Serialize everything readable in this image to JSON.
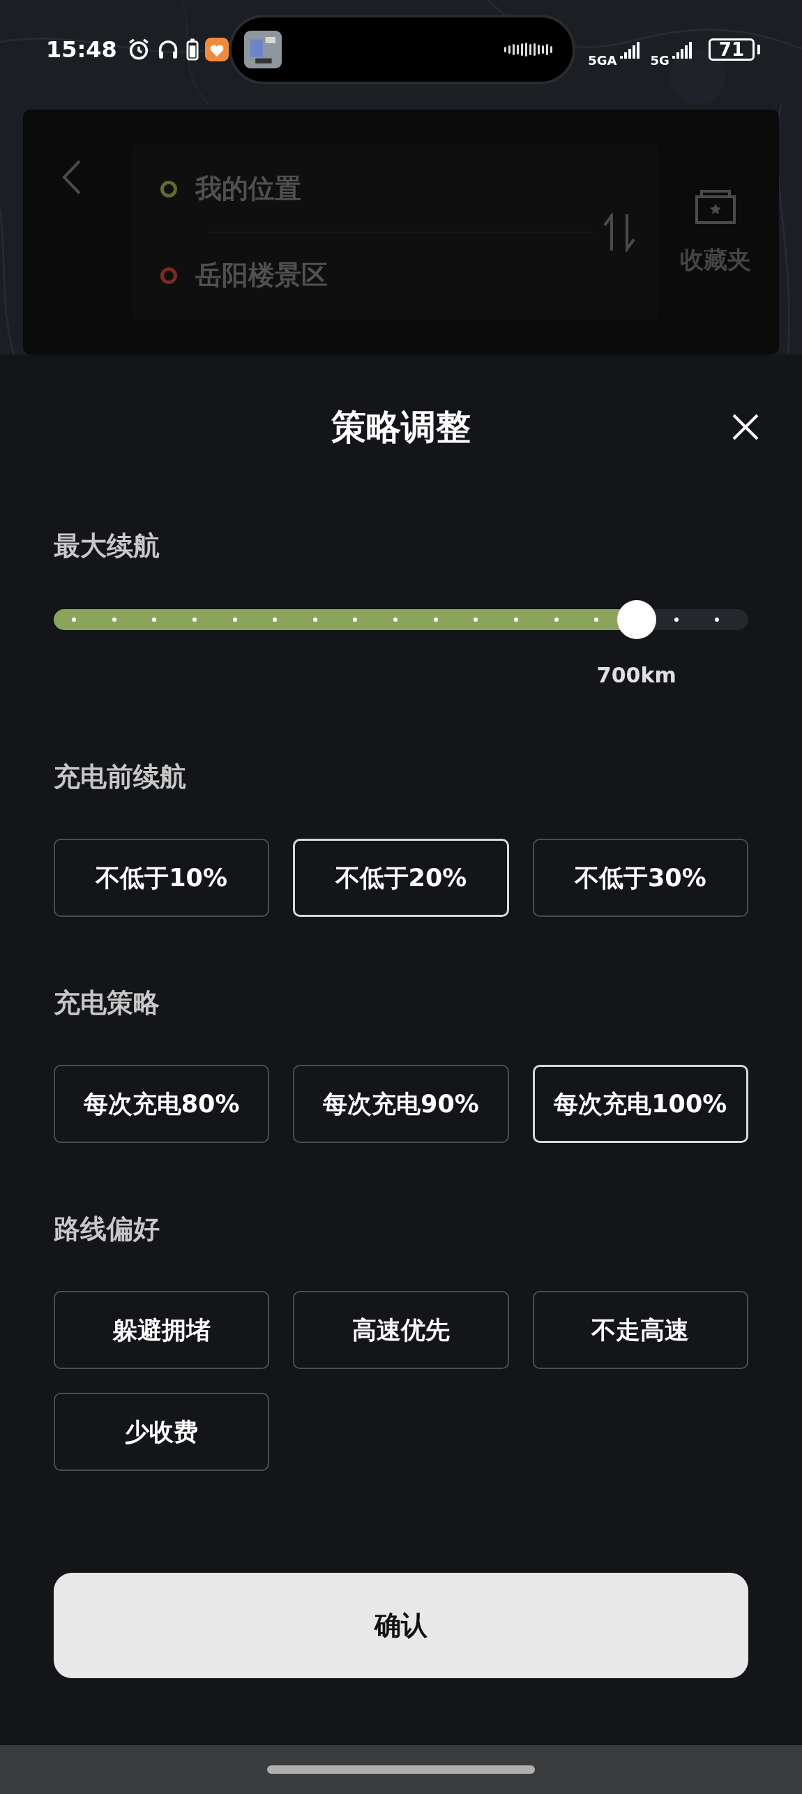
{
  "status_bar": {
    "time": "15:48",
    "network_1": "5GA",
    "network_2": "5G",
    "battery": "71"
  },
  "route_card": {
    "origin": "我的位置",
    "destination": "岳阳楼景区",
    "favorites_label": "收藏夹"
  },
  "sheet": {
    "title": "策略调整"
  },
  "range": {
    "label": "最大续航",
    "level": 0.875,
    "reading": "700km"
  },
  "sections": [
    {
      "title": "充电前续航",
      "options": [
        {
          "label": "不低于10%",
          "selected": false
        },
        {
          "label": "不低于20%",
          "selected": true
        },
        {
          "label": "不低于30%",
          "selected": false
        }
      ]
    },
    {
      "title": "充电策略",
      "options": [
        {
          "label": "每次充电80%",
          "selected": false
        },
        {
          "label": "每次充电90%",
          "selected": false
        },
        {
          "label": "每次充电100%",
          "selected": true
        }
      ]
    },
    {
      "title": "路线偏好",
      "options": [
        {
          "label": "躲避拥堵",
          "selected": false
        },
        {
          "label": "高速优先",
          "selected": false
        },
        {
          "label": "不走高速",
          "selected": false
        },
        {
          "label": "少收费",
          "selected": false
        }
      ]
    }
  ],
  "confirm_button": "确认"
}
